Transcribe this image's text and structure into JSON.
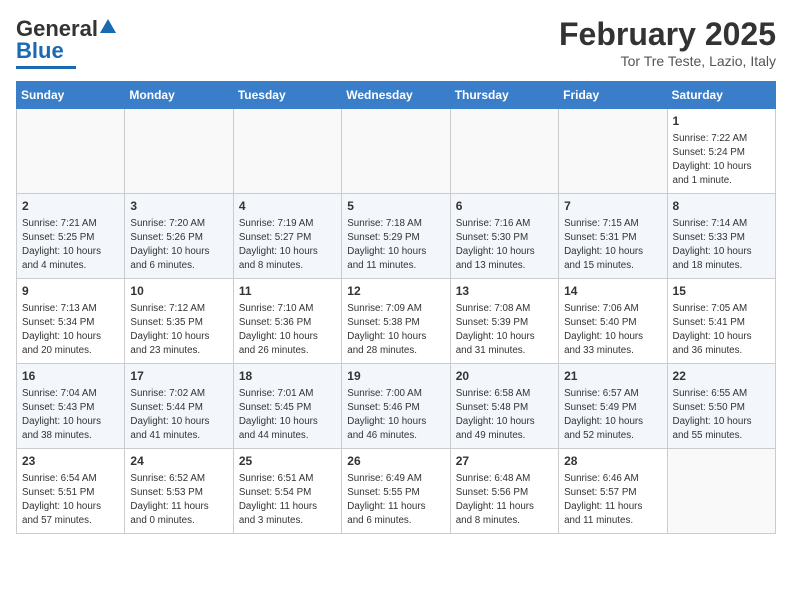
{
  "logo": {
    "text_general": "General",
    "text_blue": "Blue"
  },
  "header": {
    "month": "February 2025",
    "location": "Tor Tre Teste, Lazio, Italy"
  },
  "days_of_week": [
    "Sunday",
    "Monday",
    "Tuesday",
    "Wednesday",
    "Thursday",
    "Friday",
    "Saturday"
  ],
  "weeks": [
    [
      {
        "day": "",
        "info": ""
      },
      {
        "day": "",
        "info": ""
      },
      {
        "day": "",
        "info": ""
      },
      {
        "day": "",
        "info": ""
      },
      {
        "day": "",
        "info": ""
      },
      {
        "day": "",
        "info": ""
      },
      {
        "day": "1",
        "info": "Sunrise: 7:22 AM\nSunset: 5:24 PM\nDaylight: 10 hours\nand 1 minute."
      }
    ],
    [
      {
        "day": "2",
        "info": "Sunrise: 7:21 AM\nSunset: 5:25 PM\nDaylight: 10 hours\nand 4 minutes."
      },
      {
        "day": "3",
        "info": "Sunrise: 7:20 AM\nSunset: 5:26 PM\nDaylight: 10 hours\nand 6 minutes."
      },
      {
        "day": "4",
        "info": "Sunrise: 7:19 AM\nSunset: 5:27 PM\nDaylight: 10 hours\nand 8 minutes."
      },
      {
        "day": "5",
        "info": "Sunrise: 7:18 AM\nSunset: 5:29 PM\nDaylight: 10 hours\nand 11 minutes."
      },
      {
        "day": "6",
        "info": "Sunrise: 7:16 AM\nSunset: 5:30 PM\nDaylight: 10 hours\nand 13 minutes."
      },
      {
        "day": "7",
        "info": "Sunrise: 7:15 AM\nSunset: 5:31 PM\nDaylight: 10 hours\nand 15 minutes."
      },
      {
        "day": "8",
        "info": "Sunrise: 7:14 AM\nSunset: 5:33 PM\nDaylight: 10 hours\nand 18 minutes."
      }
    ],
    [
      {
        "day": "9",
        "info": "Sunrise: 7:13 AM\nSunset: 5:34 PM\nDaylight: 10 hours\nand 20 minutes."
      },
      {
        "day": "10",
        "info": "Sunrise: 7:12 AM\nSunset: 5:35 PM\nDaylight: 10 hours\nand 23 minutes."
      },
      {
        "day": "11",
        "info": "Sunrise: 7:10 AM\nSunset: 5:36 PM\nDaylight: 10 hours\nand 26 minutes."
      },
      {
        "day": "12",
        "info": "Sunrise: 7:09 AM\nSunset: 5:38 PM\nDaylight: 10 hours\nand 28 minutes."
      },
      {
        "day": "13",
        "info": "Sunrise: 7:08 AM\nSunset: 5:39 PM\nDaylight: 10 hours\nand 31 minutes."
      },
      {
        "day": "14",
        "info": "Sunrise: 7:06 AM\nSunset: 5:40 PM\nDaylight: 10 hours\nand 33 minutes."
      },
      {
        "day": "15",
        "info": "Sunrise: 7:05 AM\nSunset: 5:41 PM\nDaylight: 10 hours\nand 36 minutes."
      }
    ],
    [
      {
        "day": "16",
        "info": "Sunrise: 7:04 AM\nSunset: 5:43 PM\nDaylight: 10 hours\nand 38 minutes."
      },
      {
        "day": "17",
        "info": "Sunrise: 7:02 AM\nSunset: 5:44 PM\nDaylight: 10 hours\nand 41 minutes."
      },
      {
        "day": "18",
        "info": "Sunrise: 7:01 AM\nSunset: 5:45 PM\nDaylight: 10 hours\nand 44 minutes."
      },
      {
        "day": "19",
        "info": "Sunrise: 7:00 AM\nSunset: 5:46 PM\nDaylight: 10 hours\nand 46 minutes."
      },
      {
        "day": "20",
        "info": "Sunrise: 6:58 AM\nSunset: 5:48 PM\nDaylight: 10 hours\nand 49 minutes."
      },
      {
        "day": "21",
        "info": "Sunrise: 6:57 AM\nSunset: 5:49 PM\nDaylight: 10 hours\nand 52 minutes."
      },
      {
        "day": "22",
        "info": "Sunrise: 6:55 AM\nSunset: 5:50 PM\nDaylight: 10 hours\nand 55 minutes."
      }
    ],
    [
      {
        "day": "23",
        "info": "Sunrise: 6:54 AM\nSunset: 5:51 PM\nDaylight: 10 hours\nand 57 minutes."
      },
      {
        "day": "24",
        "info": "Sunrise: 6:52 AM\nSunset: 5:53 PM\nDaylight: 11 hours\nand 0 minutes."
      },
      {
        "day": "25",
        "info": "Sunrise: 6:51 AM\nSunset: 5:54 PM\nDaylight: 11 hours\nand 3 minutes."
      },
      {
        "day": "26",
        "info": "Sunrise: 6:49 AM\nSunset: 5:55 PM\nDaylight: 11 hours\nand 6 minutes."
      },
      {
        "day": "27",
        "info": "Sunrise: 6:48 AM\nSunset: 5:56 PM\nDaylight: 11 hours\nand 8 minutes."
      },
      {
        "day": "28",
        "info": "Sunrise: 6:46 AM\nSunset: 5:57 PM\nDaylight: 11 hours\nand 11 minutes."
      },
      {
        "day": "",
        "info": ""
      }
    ]
  ]
}
